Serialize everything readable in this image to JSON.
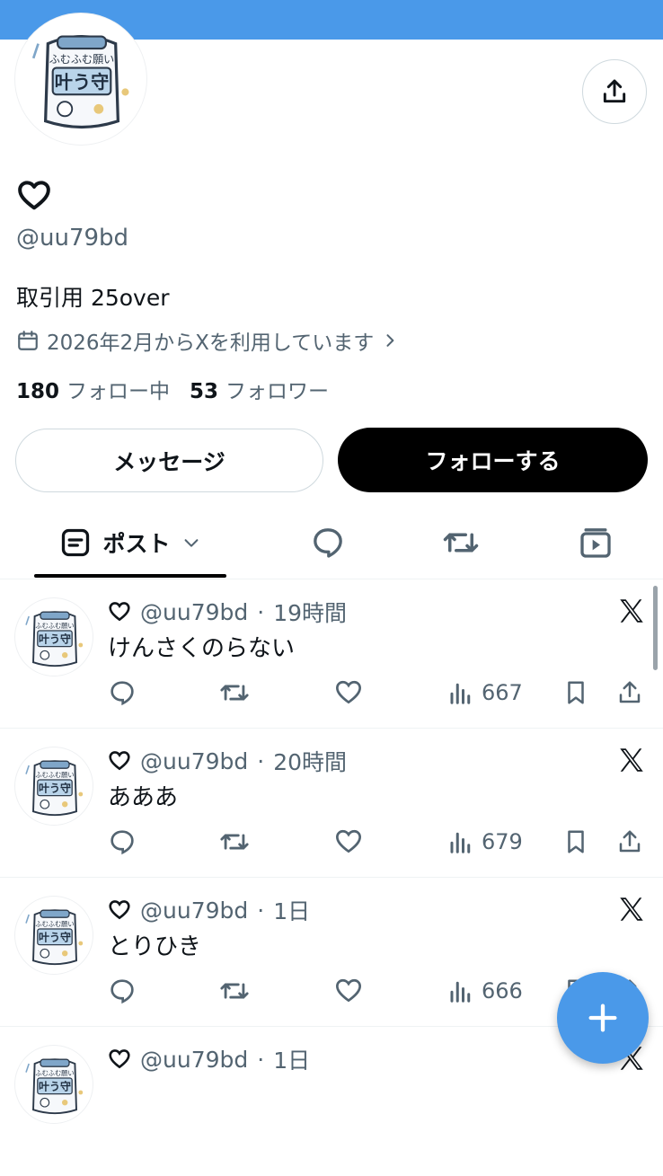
{
  "colors": {
    "banner": "#4a99e9",
    "accent": "#1d9bf0",
    "muted": "#536471",
    "follow_button": "#000000"
  },
  "profile": {
    "display_name_icon": "heart-outline-icon",
    "handle": "@uu79bd",
    "bio": "取引用 25over",
    "joined": "2026年2月からXを利用しています",
    "following_count": "180",
    "following_label": "フォロー中",
    "followers_count": "53",
    "followers_label": "フォロワー"
  },
  "buttons": {
    "message": "メッセージ",
    "follow": "フォローする"
  },
  "tabs": {
    "posts_label": "ポスト"
  },
  "posts": [
    {
      "handle": "@uu79bd",
      "sep": "·",
      "time": "19時間",
      "text": "けんさくのらない",
      "views": "667"
    },
    {
      "handle": "@uu79bd",
      "sep": "·",
      "time": "20時間",
      "text": "あああ",
      "views": "679"
    },
    {
      "handle": "@uu79bd",
      "sep": "·",
      "time": "1日",
      "text": "とりひき",
      "views": "666"
    },
    {
      "handle": "@uu79bd",
      "sep": "·",
      "time": "1日",
      "text": "",
      "views": ""
    }
  ]
}
